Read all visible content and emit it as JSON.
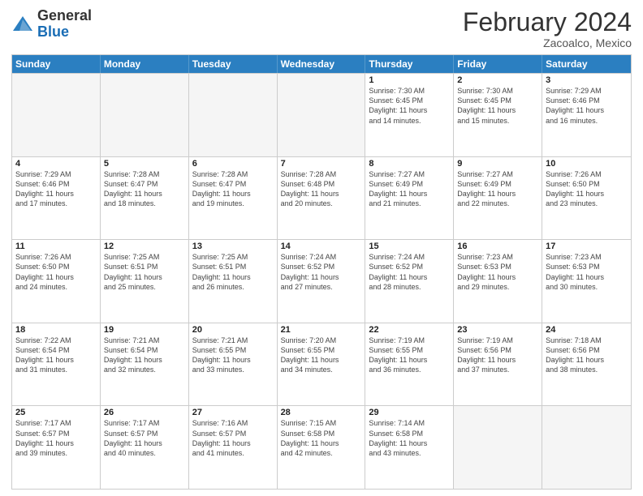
{
  "header": {
    "logo_general": "General",
    "logo_blue": "Blue",
    "title": "February 2024",
    "subtitle": "Zacoalco, Mexico"
  },
  "days_of_week": [
    "Sunday",
    "Monday",
    "Tuesday",
    "Wednesday",
    "Thursday",
    "Friday",
    "Saturday"
  ],
  "weeks": [
    [
      {
        "day": "",
        "info": "",
        "empty": true
      },
      {
        "day": "",
        "info": "",
        "empty": true
      },
      {
        "day": "",
        "info": "",
        "empty": true
      },
      {
        "day": "",
        "info": "",
        "empty": true
      },
      {
        "day": "1",
        "info": "Sunrise: 7:30 AM\nSunset: 6:45 PM\nDaylight: 11 hours\nand 14 minutes.",
        "empty": false
      },
      {
        "day": "2",
        "info": "Sunrise: 7:30 AM\nSunset: 6:45 PM\nDaylight: 11 hours\nand 15 minutes.",
        "empty": false
      },
      {
        "day": "3",
        "info": "Sunrise: 7:29 AM\nSunset: 6:46 PM\nDaylight: 11 hours\nand 16 minutes.",
        "empty": false
      }
    ],
    [
      {
        "day": "4",
        "info": "Sunrise: 7:29 AM\nSunset: 6:46 PM\nDaylight: 11 hours\nand 17 minutes.",
        "empty": false
      },
      {
        "day": "5",
        "info": "Sunrise: 7:28 AM\nSunset: 6:47 PM\nDaylight: 11 hours\nand 18 minutes.",
        "empty": false
      },
      {
        "day": "6",
        "info": "Sunrise: 7:28 AM\nSunset: 6:47 PM\nDaylight: 11 hours\nand 19 minutes.",
        "empty": false
      },
      {
        "day": "7",
        "info": "Sunrise: 7:28 AM\nSunset: 6:48 PM\nDaylight: 11 hours\nand 20 minutes.",
        "empty": false
      },
      {
        "day": "8",
        "info": "Sunrise: 7:27 AM\nSunset: 6:49 PM\nDaylight: 11 hours\nand 21 minutes.",
        "empty": false
      },
      {
        "day": "9",
        "info": "Sunrise: 7:27 AM\nSunset: 6:49 PM\nDaylight: 11 hours\nand 22 minutes.",
        "empty": false
      },
      {
        "day": "10",
        "info": "Sunrise: 7:26 AM\nSunset: 6:50 PM\nDaylight: 11 hours\nand 23 minutes.",
        "empty": false
      }
    ],
    [
      {
        "day": "11",
        "info": "Sunrise: 7:26 AM\nSunset: 6:50 PM\nDaylight: 11 hours\nand 24 minutes.",
        "empty": false
      },
      {
        "day": "12",
        "info": "Sunrise: 7:25 AM\nSunset: 6:51 PM\nDaylight: 11 hours\nand 25 minutes.",
        "empty": false
      },
      {
        "day": "13",
        "info": "Sunrise: 7:25 AM\nSunset: 6:51 PM\nDaylight: 11 hours\nand 26 minutes.",
        "empty": false
      },
      {
        "day": "14",
        "info": "Sunrise: 7:24 AM\nSunset: 6:52 PM\nDaylight: 11 hours\nand 27 minutes.",
        "empty": false
      },
      {
        "day": "15",
        "info": "Sunrise: 7:24 AM\nSunset: 6:52 PM\nDaylight: 11 hours\nand 28 minutes.",
        "empty": false
      },
      {
        "day": "16",
        "info": "Sunrise: 7:23 AM\nSunset: 6:53 PM\nDaylight: 11 hours\nand 29 minutes.",
        "empty": false
      },
      {
        "day": "17",
        "info": "Sunrise: 7:23 AM\nSunset: 6:53 PM\nDaylight: 11 hours\nand 30 minutes.",
        "empty": false
      }
    ],
    [
      {
        "day": "18",
        "info": "Sunrise: 7:22 AM\nSunset: 6:54 PM\nDaylight: 11 hours\nand 31 minutes.",
        "empty": false
      },
      {
        "day": "19",
        "info": "Sunrise: 7:21 AM\nSunset: 6:54 PM\nDaylight: 11 hours\nand 32 minutes.",
        "empty": false
      },
      {
        "day": "20",
        "info": "Sunrise: 7:21 AM\nSunset: 6:55 PM\nDaylight: 11 hours\nand 33 minutes.",
        "empty": false
      },
      {
        "day": "21",
        "info": "Sunrise: 7:20 AM\nSunset: 6:55 PM\nDaylight: 11 hours\nand 34 minutes.",
        "empty": false
      },
      {
        "day": "22",
        "info": "Sunrise: 7:19 AM\nSunset: 6:55 PM\nDaylight: 11 hours\nand 36 minutes.",
        "empty": false
      },
      {
        "day": "23",
        "info": "Sunrise: 7:19 AM\nSunset: 6:56 PM\nDaylight: 11 hours\nand 37 minutes.",
        "empty": false
      },
      {
        "day": "24",
        "info": "Sunrise: 7:18 AM\nSunset: 6:56 PM\nDaylight: 11 hours\nand 38 minutes.",
        "empty": false
      }
    ],
    [
      {
        "day": "25",
        "info": "Sunrise: 7:17 AM\nSunset: 6:57 PM\nDaylight: 11 hours\nand 39 minutes.",
        "empty": false
      },
      {
        "day": "26",
        "info": "Sunrise: 7:17 AM\nSunset: 6:57 PM\nDaylight: 11 hours\nand 40 minutes.",
        "empty": false
      },
      {
        "day": "27",
        "info": "Sunrise: 7:16 AM\nSunset: 6:57 PM\nDaylight: 11 hours\nand 41 minutes.",
        "empty": false
      },
      {
        "day": "28",
        "info": "Sunrise: 7:15 AM\nSunset: 6:58 PM\nDaylight: 11 hours\nand 42 minutes.",
        "empty": false
      },
      {
        "day": "29",
        "info": "Sunrise: 7:14 AM\nSunset: 6:58 PM\nDaylight: 11 hours\nand 43 minutes.",
        "empty": false
      },
      {
        "day": "",
        "info": "",
        "empty": true
      },
      {
        "day": "",
        "info": "",
        "empty": true
      }
    ]
  ]
}
